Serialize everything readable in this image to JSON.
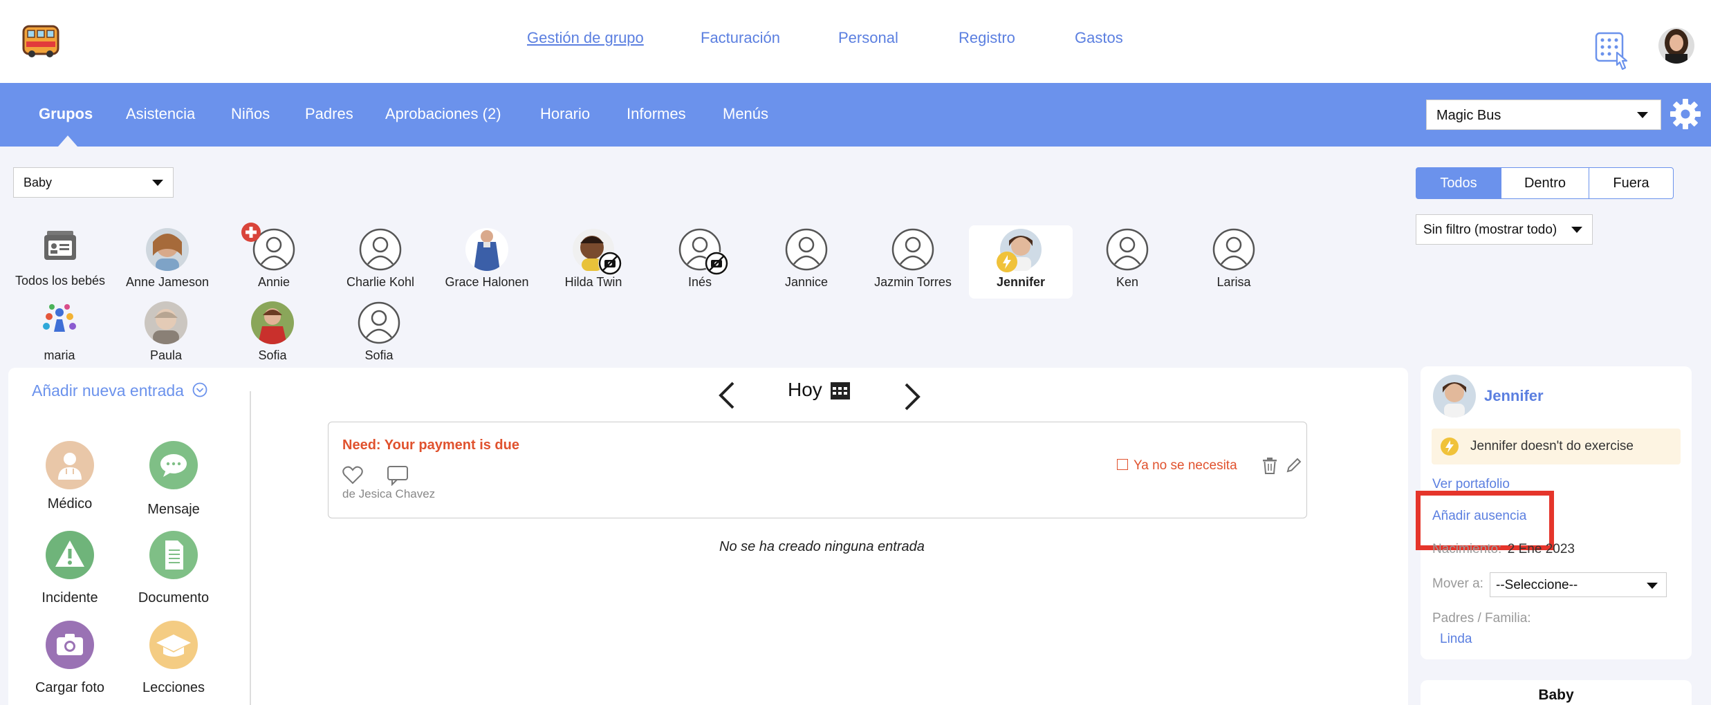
{
  "topnav": {
    "links": [
      "Gestión de grupo",
      "Facturación",
      "Personal",
      "Registro",
      "Gastos"
    ]
  },
  "mainnav": {
    "items": [
      "Grupos",
      "Asistencia",
      "Niños",
      "Padres",
      "Aprobaciones (2)",
      "Horario",
      "Informes",
      "Menús"
    ],
    "center_select": "Magic Bus"
  },
  "filters": {
    "group_select": "Baby",
    "segments": [
      "Todos",
      "Dentro",
      "Fuera"
    ],
    "filter_select": "Sin filtro (mostrar todo)"
  },
  "kids": {
    "all_label": "Todos los bebés",
    "names": [
      "Anne Jameson",
      "Annie",
      "Charlie Kohl",
      "Grace Halonen",
      "Hilda Twin",
      "Inés",
      "Jannice",
      "Jazmin Torres",
      "Jennifer",
      "Ken",
      "Larisa",
      "maria",
      "Paula",
      "Sofia",
      "Sofia"
    ]
  },
  "entries": {
    "add_new": "Añadir nueva entrada",
    "date_label": "Hoy",
    "tools": [
      "Médico",
      "Mensaje",
      "Incidente",
      "Documento",
      "Cargar foto",
      "Lecciones"
    ],
    "card": {
      "title": "Need: Your payment is due",
      "not_needed": "Ya no se necesita",
      "from": "de Jesica Chavez"
    },
    "empty": "No se ha creado ninguna entrada"
  },
  "profile": {
    "name": "Jennifer",
    "note": "Jennifer doesn't do exercise",
    "portfolio": "Ver portafolio",
    "add_absence": "Añadir ausencia",
    "birth_label": "Nacimiento:",
    "birth_value": "2 Ene 2023",
    "move_label": "Mover a:",
    "move_select": "--Seleccione--",
    "parents_label": "Padres / Familia:",
    "parent": "Linda",
    "group_card": "Baby"
  },
  "colors": {
    "accent": "#6b92ec",
    "alert": "#e0522e",
    "highlight_box": "#e5352b"
  }
}
